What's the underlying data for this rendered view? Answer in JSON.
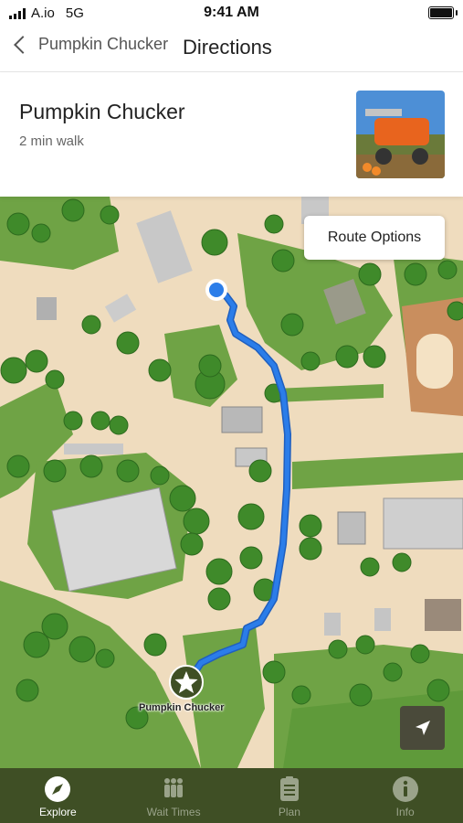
{
  "status": {
    "carrier": "A.io",
    "network": "5G",
    "time": "9:41 AM"
  },
  "nav": {
    "back_label": "Pumpkin Chucker",
    "title": "Directions"
  },
  "attraction": {
    "name": "Pumpkin Chucker",
    "walk_time": "2 min walk"
  },
  "map": {
    "route_options_label": "Route Options",
    "destination_label": "Pumpkin Chucker",
    "route_color": "#2b7de9"
  },
  "tabs": [
    {
      "label": "Explore",
      "icon": "compass-icon",
      "active": true
    },
    {
      "label": "Wait Times",
      "icon": "people-queue-icon",
      "active": false
    },
    {
      "label": "Plan",
      "icon": "clipboard-list-icon",
      "active": false
    },
    {
      "label": "Info",
      "icon": "info-icon",
      "active": false
    }
  ],
  "colors": {
    "tab_bar": "#3f4f25",
    "grass": "#6fa345",
    "path": "#efdcbe"
  }
}
